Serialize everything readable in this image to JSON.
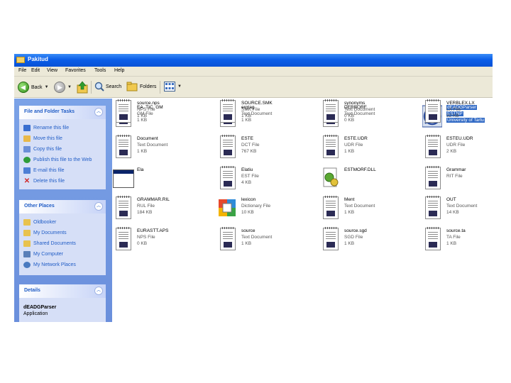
{
  "window": {
    "title": "Pakitud"
  },
  "menu": [
    "File",
    "Edit",
    "View",
    "Favorites",
    "Tools",
    "Help"
  ],
  "toolbar": {
    "back": "Back",
    "search": "Search",
    "folders": "Folders"
  },
  "sidebar": {
    "file_tasks": {
      "title": "File and Folder Tasks",
      "items": [
        {
          "label": "Rename this file",
          "icon": "rename-icon",
          "color": "#3a6fd0"
        },
        {
          "label": "Move this file",
          "icon": "move-icon",
          "color": "#e8b84a"
        },
        {
          "label": "Copy this file",
          "icon": "copy-icon",
          "color": "#6b8fd8"
        },
        {
          "label": "Publish this file to the Web",
          "icon": "globe-icon",
          "color": "#2f9d3a"
        },
        {
          "label": "E-mail this file",
          "icon": "mail-icon",
          "color": "#4d7fd5"
        },
        {
          "label": "Delete this file",
          "icon": "delete-icon",
          "color": "#d02828"
        }
      ]
    },
    "other_places": {
      "title": "Other Places",
      "items": [
        {
          "label": "Oldbooker",
          "icon": "folder-icon",
          "color": "#e8c24e"
        },
        {
          "label": "My Documents",
          "icon": "folder-icon",
          "color": "#e8c24e"
        },
        {
          "label": "Shared Documents",
          "icon": "folder-icon",
          "color": "#e8c24e"
        },
        {
          "label": "My Computer",
          "icon": "computer-icon",
          "color": "#5a7fb8"
        },
        {
          "label": "My Network Places",
          "icon": "network-icon",
          "color": "#4a7ac0"
        }
      ]
    },
    "details": {
      "title": "Details",
      "name": "dEADGParser",
      "type": "Application"
    }
  },
  "files": [
    {
      "name": "EA. TIC. GM",
      "type": "GM File",
      "size": "1 KB",
      "icon": "document-icon"
    },
    {
      "name": "ergtag",
      "type": "Text Document",
      "size": "1 KB",
      "icon": "text-document-icon"
    },
    {
      "name": "DERBORF",
      "type": "Text Document",
      "size": "0 KB",
      "icon": "text-document-icon"
    },
    {
      "name": "dEADGParser",
      "type": "ESTNP",
      "size": "University of Tartu",
      "icon": "application-icon",
      "selected": true
    },
    {
      "name": "Document",
      "type": "Text Document",
      "size": "1 KB",
      "icon": "text-document-icon"
    },
    {
      "name": "ESTE",
      "type": "DCT File",
      "size": "767 KB",
      "icon": "document-icon"
    },
    {
      "name": "ESTE.UDR",
      "type": "UDR File",
      "size": "1 KB",
      "icon": "document-icon"
    },
    {
      "name": "ESTEU.UDR",
      "type": "UDR File",
      "size": "2 KB",
      "icon": "document-icon"
    },
    {
      "name": "Ela",
      "type": "",
      "size": "",
      "icon": "window-icon"
    },
    {
      "name": "Elatiu",
      "type": "EST File",
      "size": "4 KB",
      "icon": "document-icon"
    },
    {
      "name": "ESTMORF.DLL",
      "type": "",
      "size": "",
      "icon": "dll-icon"
    },
    {
      "name": "Grammar",
      "type": "RIT File",
      "size": "",
      "icon": "document-icon"
    },
    {
      "name": "GRAMMAR.RIL",
      "type": "RUL File",
      "size": "184 KB",
      "icon": "document-icon"
    },
    {
      "name": "lexicon",
      "type": "Dictionary File",
      "size": "10 KB",
      "icon": "office-icon"
    },
    {
      "name": "Ment",
      "type": "Text Document",
      "size": "1 KB",
      "icon": "text-document-icon"
    },
    {
      "name": "OUT",
      "type": "Text Document",
      "size": "14 KB",
      "icon": "text-document-icon"
    },
    {
      "name": "EURASTT.APS",
      "type": "NPS File",
      "size": "0 KB",
      "icon": "document-icon"
    },
    {
      "name": "source",
      "type": "Text Document",
      "size": "1 KB",
      "icon": "text-document-icon"
    },
    {
      "name": "source.sgd",
      "type": "SGD File",
      "size": "1 KB",
      "icon": "document-icon"
    },
    {
      "name": "source.ta",
      "type": "TA File",
      "size": "1 KB",
      "icon": "document-icon"
    },
    {
      "name": "source.nps",
      "type": "NPS File",
      "size": "1 KB",
      "icon": "document-icon"
    },
    {
      "name": "SOURCE.SMK",
      "type": "SMK File",
      "size": "1 KB",
      "icon": "document-icon"
    },
    {
      "name": "synonyms",
      "type": "Text Document",
      "size": "0 KB",
      "icon": "text-document-icon"
    },
    {
      "name": "VERBLEX.LX",
      "type": "LX File",
      "size": "32 KB",
      "icon": "document-icon"
    }
  ]
}
